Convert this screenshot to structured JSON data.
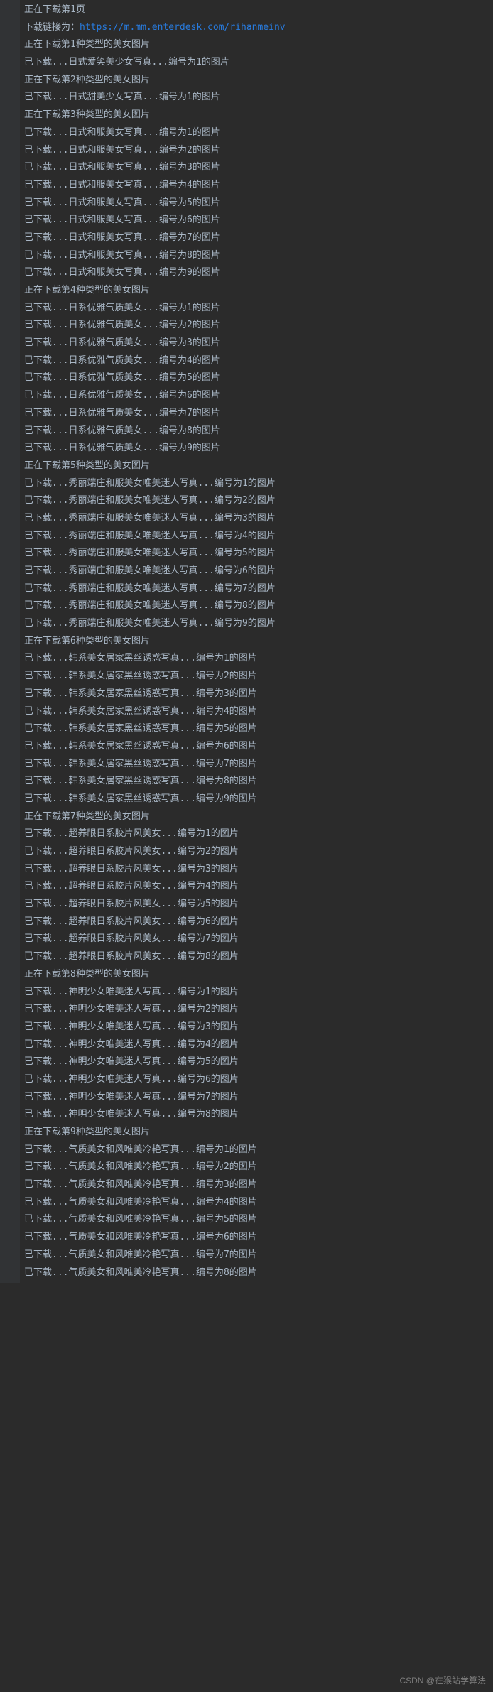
{
  "intro": {
    "line0": "正在下载第1页",
    "url_label": "下载链接为：",
    "url": "https://m.mm.enterdesk.com/rihanmeinv"
  },
  "blocks": [
    {
      "heading": "正在下载第1种类型的美女图片",
      "items": [
        "已下载...日式爱笑美少女写真...编号为1的图片"
      ]
    },
    {
      "heading": "正在下载第2种类型的美女图片",
      "items": [
        "已下载...日式甜美少女写真...编号为1的图片"
      ]
    },
    {
      "heading": "正在下载第3种类型的美女图片",
      "items": [
        "已下载...日式和服美女写真...编号为1的图片",
        "已下载...日式和服美女写真...编号为2的图片",
        "已下载...日式和服美女写真...编号为3的图片",
        "已下载...日式和服美女写真...编号为4的图片",
        "已下载...日式和服美女写真...编号为5的图片",
        "已下载...日式和服美女写真...编号为6的图片",
        "已下载...日式和服美女写真...编号为7的图片",
        "已下载...日式和服美女写真...编号为8的图片",
        "已下载...日式和服美女写真...编号为9的图片"
      ]
    },
    {
      "heading": "正在下载第4种类型的美女图片",
      "items": [
        "已下载...日系优雅气质美女...编号为1的图片",
        "已下载...日系优雅气质美女...编号为2的图片",
        "已下载...日系优雅气质美女...编号为3的图片",
        "已下载...日系优雅气质美女...编号为4的图片",
        "已下载...日系优雅气质美女...编号为5的图片",
        "已下载...日系优雅气质美女...编号为6的图片",
        "已下载...日系优雅气质美女...编号为7的图片",
        "已下载...日系优雅气质美女...编号为8的图片",
        "已下载...日系优雅气质美女...编号为9的图片"
      ]
    },
    {
      "heading": "正在下载第5种类型的美女图片",
      "items": [
        "已下载...秀丽端庄和服美女唯美迷人写真...编号为1的图片",
        "已下载...秀丽端庄和服美女唯美迷人写真...编号为2的图片",
        "已下载...秀丽端庄和服美女唯美迷人写真...编号为3的图片",
        "已下载...秀丽端庄和服美女唯美迷人写真...编号为4的图片",
        "已下载...秀丽端庄和服美女唯美迷人写真...编号为5的图片",
        "已下载...秀丽端庄和服美女唯美迷人写真...编号为6的图片",
        "已下载...秀丽端庄和服美女唯美迷人写真...编号为7的图片",
        "已下载...秀丽端庄和服美女唯美迷人写真...编号为8的图片",
        "已下载...秀丽端庄和服美女唯美迷人写真...编号为9的图片"
      ]
    },
    {
      "heading": "正在下载第6种类型的美女图片",
      "items": [
        "已下载...韩系美女居家黑丝诱惑写真...编号为1的图片",
        "已下载...韩系美女居家黑丝诱惑写真...编号为2的图片",
        "已下载...韩系美女居家黑丝诱惑写真...编号为3的图片",
        "已下载...韩系美女居家黑丝诱惑写真...编号为4的图片",
        "已下载...韩系美女居家黑丝诱惑写真...编号为5的图片",
        "已下载...韩系美女居家黑丝诱惑写真...编号为6的图片",
        "已下载...韩系美女居家黑丝诱惑写真...编号为7的图片",
        "已下载...韩系美女居家黑丝诱惑写真...编号为8的图片",
        "已下载...韩系美女居家黑丝诱惑写真...编号为9的图片"
      ]
    },
    {
      "heading": "正在下载第7种类型的美女图片",
      "items": [
        "已下载...超养眼日系胶片风美女...编号为1的图片",
        "已下载...超养眼日系胶片风美女...编号为2的图片",
        "已下载...超养眼日系胶片风美女...编号为3的图片",
        "已下载...超养眼日系胶片风美女...编号为4的图片",
        "已下载...超养眼日系胶片风美女...编号为5的图片",
        "已下载...超养眼日系胶片风美女...编号为6的图片",
        "已下载...超养眼日系胶片风美女...编号为7的图片",
        "已下载...超养眼日系胶片风美女...编号为8的图片"
      ]
    },
    {
      "heading": "正在下载第8种类型的美女图片",
      "items": [
        "已下载...神明少女唯美迷人写真...编号为1的图片",
        "已下载...神明少女唯美迷人写真...编号为2的图片",
        "已下载...神明少女唯美迷人写真...编号为3的图片",
        "已下载...神明少女唯美迷人写真...编号为4的图片",
        "已下载...神明少女唯美迷人写真...编号为5的图片",
        "已下载...神明少女唯美迷人写真...编号为6的图片",
        "已下载...神明少女唯美迷人写真...编号为7的图片",
        "已下载...神明少女唯美迷人写真...编号为8的图片"
      ]
    },
    {
      "heading": "正在下载第9种类型的美女图片",
      "items": [
        "已下载...气质美女和风唯美冷艳写真...编号为1的图片",
        "已下载...气质美女和风唯美冷艳写真...编号为2的图片",
        "已下载...气质美女和风唯美冷艳写真...编号为3的图片",
        "已下载...气质美女和风唯美冷艳写真...编号为4的图片",
        "已下载...气质美女和风唯美冷艳写真...编号为5的图片",
        "已下载...气质美女和风唯美冷艳写真...编号为6的图片",
        "已下载...气质美女和风唯美冷艳写真...编号为7的图片",
        "已下载...气质美女和风唯美冷艳写真...编号为8的图片"
      ]
    }
  ],
  "watermark": "CSDN @在猴站学算法"
}
